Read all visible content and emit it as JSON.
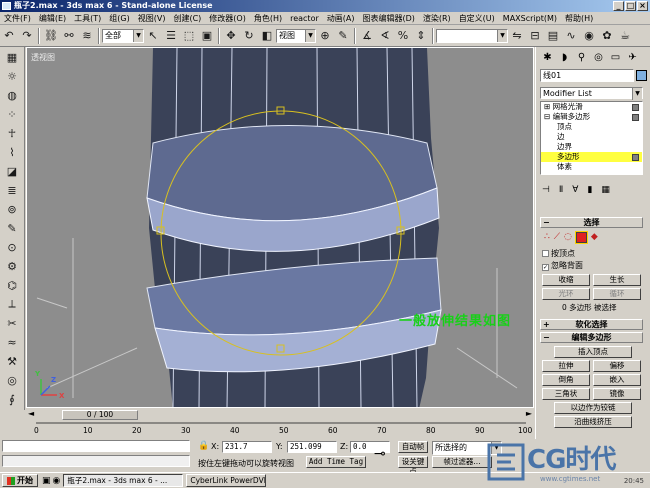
{
  "window": {
    "title": "瓶子2.max - 3ds max 6 - Stand-alone License",
    "buttons": [
      "_",
      "□",
      "×"
    ]
  },
  "menu": [
    "文件(F)",
    "编辑(E)",
    "工具(T)",
    "组(G)",
    "视图(V)",
    "创建(C)",
    "修改器(O)",
    "角色(H)",
    "reactor",
    "动画(A)",
    "图表编辑器(D)",
    "渲染(R)",
    "自定义(U)",
    "MAXScript(M)",
    "帮助(H)"
  ],
  "toolbar": {
    "selection_filter": "全部",
    "ref_coord": "视图",
    "named_sel": ""
  },
  "viewport": {
    "label": "透视图",
    "note": "一般放伸结果如图",
    "axis_x": "X",
    "axis_y": "Y",
    "axis_z": "Z"
  },
  "cmd_panel": {
    "object_name": "线01",
    "object_color": "#7fb0e0",
    "modifier_list_label": "Modifier List",
    "stack": [
      {
        "label": "网格光滑",
        "level": 0,
        "selected": false
      },
      {
        "label": "编辑多边形",
        "level": 0,
        "selected": false
      },
      {
        "label": "顶点",
        "level": 1,
        "selected": false
      },
      {
        "label": "边",
        "level": 1,
        "selected": false
      },
      {
        "label": "边界",
        "level": 1,
        "selected": false
      },
      {
        "label": "多边形",
        "level": 1,
        "selected": true
      },
      {
        "label": "体素",
        "level": 1,
        "selected": false
      }
    ],
    "rollout_selection": "选择",
    "by_vertex": "按顶点",
    "ignore_backfacing": "忽略背面",
    "shrink": "收缩",
    "grow": "生长",
    "ring": "光环",
    "loop": "循环",
    "selected_count": "0 多边形 被选择",
    "rollout_soft": "软化选择",
    "rollout_edit": "编辑多边形",
    "insert_vertex": "插入顶点",
    "extrude": "拉伸",
    "outline": "偏移",
    "bevel": "倒角",
    "inset": "嵌入",
    "triangulate": "三角状",
    "flip": "镜像",
    "hinge": "以边作为铰链",
    "extrude_along": "沿曲线挤压"
  },
  "timeline": {
    "frame": "0 / 100"
  },
  "ruler": [
    "0",
    "10",
    "20",
    "30",
    "40",
    "50",
    "60",
    "70",
    "80",
    "90",
    "100"
  ],
  "status": {
    "x_label": "X:",
    "x_value": "231.7",
    "y_label": "Y:",
    "y_value": "251.099",
    "z_label": "Z:",
    "z_value": "0.0",
    "prompt": "按住左键拖动可以旋转视图",
    "add_time_tag": "Add Time Tag",
    "auto_key": "自动帧",
    "set_key": "设关键点",
    "key_mode": "所选择的",
    "key_filters": "帧过滤器..."
  },
  "taskbar": {
    "start": "开始",
    "tasks": [
      "瓶子2.max - 3ds max 6 - ...",
      "CyberLink PowerDVD"
    ],
    "clock": "20:45"
  },
  "watermark": {
    "big": "CG时代",
    "small": "www.cgtimes.net"
  }
}
